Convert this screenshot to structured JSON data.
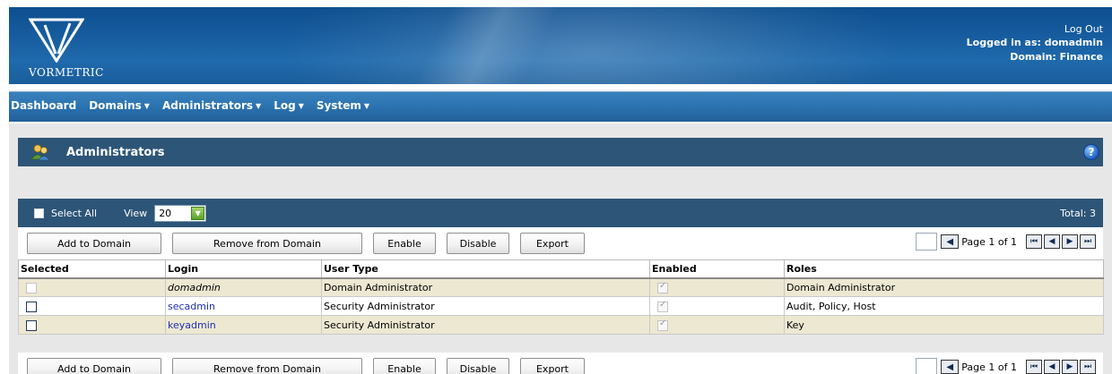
{
  "header": {
    "logo_text": "VORMETRIC",
    "logout": "Log Out",
    "logged_in_as": "Logged in as: domadmin",
    "domain": "Domain: Finance"
  },
  "nav": [
    {
      "label": "Dashboard",
      "has_menu": false
    },
    {
      "label": "Domains",
      "has_menu": true
    },
    {
      "label": "Administrators",
      "has_menu": true
    },
    {
      "label": "Log",
      "has_menu": true
    },
    {
      "label": "System",
      "has_menu": true
    }
  ],
  "panel": {
    "title": "Administrators",
    "select_all": "Select All",
    "view_label": "View",
    "view_value": "20",
    "total": "Total: 3"
  },
  "buttons": {
    "add_to_domain": "Add to Domain",
    "remove_from_domain": "Remove from Domain",
    "enable": "Enable",
    "disable": "Disable",
    "export": "Export"
  },
  "pager": {
    "text": "Page 1 of 1"
  },
  "table": {
    "columns": [
      "Selected",
      "Login",
      "User Type",
      "Enabled",
      "Roles"
    ],
    "rows": [
      {
        "login": "domadmin",
        "user_type": "Domain Administrator",
        "roles": "Domain Administrator",
        "selectable": false,
        "enabled": true
      },
      {
        "login": "secadmin",
        "user_type": "Security Administrator",
        "roles": "Audit, Policy, Host",
        "selectable": true,
        "enabled": true
      },
      {
        "login": "keyadmin",
        "user_type": "Security Administrator",
        "roles": "Key",
        "selectable": true,
        "enabled": true
      }
    ]
  },
  "colors": {
    "banner": "#1a5d9b",
    "panel_header": "#2d5577",
    "row_alt": "#ede8d2",
    "link": "#1f2fb5"
  }
}
